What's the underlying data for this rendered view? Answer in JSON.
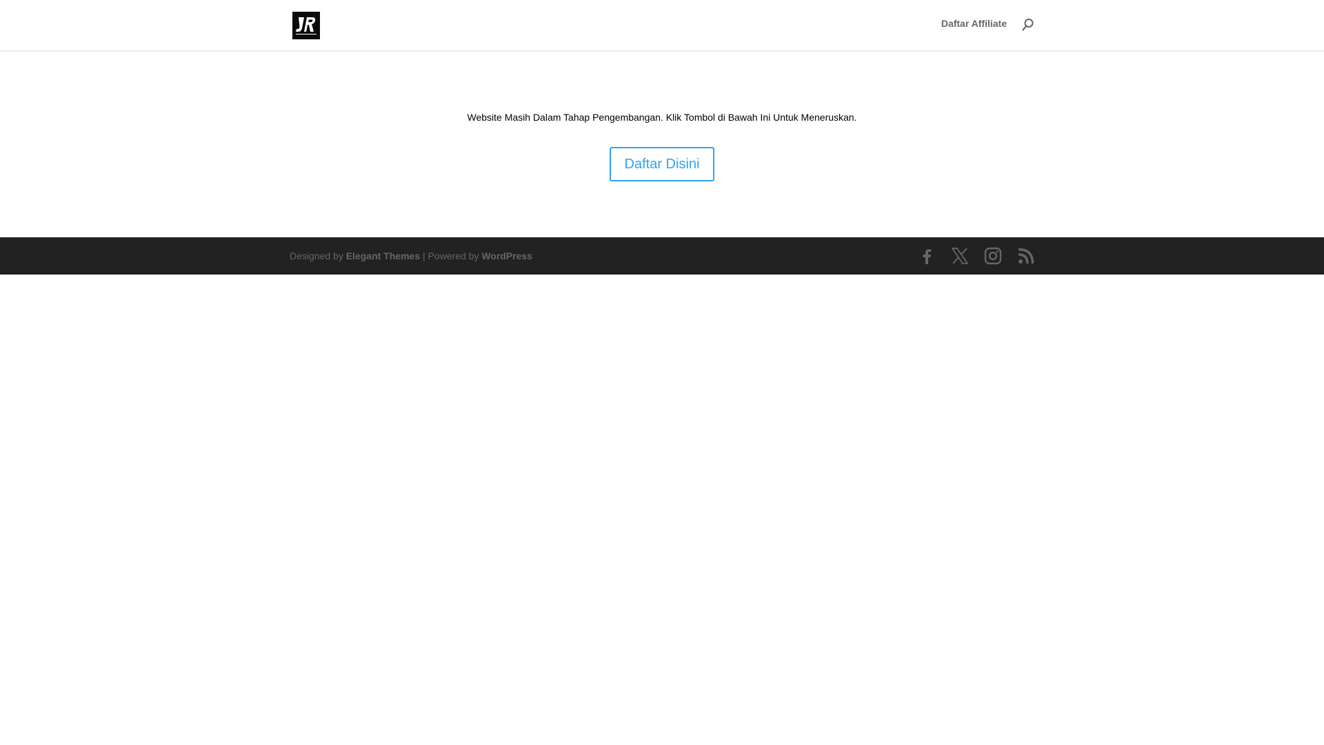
{
  "header": {
    "logo_icon": "jr-logo-icon",
    "nav": [
      {
        "label": "Daftar Affiliate"
      }
    ],
    "search_icon": "search-icon"
  },
  "main": {
    "notice": "Website Masih Dalam Tahap Pengembangan. Klik Tombol di Bawah Ini Untuk Meneruskan.",
    "button_label": "Daftar Disini"
  },
  "footer": {
    "credits": {
      "designed_by_prefix": "Designed by",
      "designer_link": "Elegant Themes",
      "separator": "| Powered by",
      "platform_link": "WordPress"
    },
    "social_icons": [
      "facebook-icon",
      "x-icon",
      "instagram-icon",
      "rss-icon"
    ]
  },
  "colors": {
    "accent": "#2ea3f2",
    "footer_bg": "#222222",
    "muted_text": "#666666"
  }
}
